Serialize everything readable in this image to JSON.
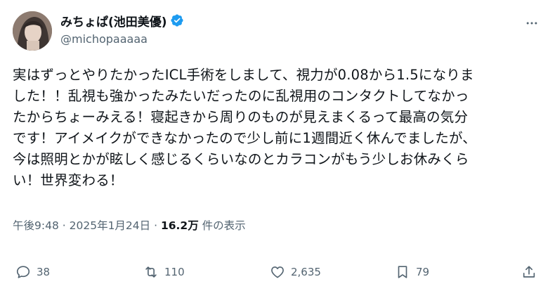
{
  "author": {
    "display_name": "みちょぱ(池田美優)",
    "handle": "@michopaaaaa",
    "verified": true,
    "icon_color": "#1d9bf0"
  },
  "tweet": {
    "lines": [
      "実はずっとやりたかったICL手術をしまして、視力が0.08から1.5になりま",
      "した！！乱視も強かったみたいだったのに乱視用のコンタクトしてなかっ",
      "たからちょーみえる！寝起きから周りのものが見えまくるって最高の気分",
      "です！アイメイクができなかったので少し前に1週間近く休んでましたが、",
      "今は照明とかが眩しく感じるくらいなのとカラコンがもう少しお休みくら",
      "い！世界変わる！"
    ]
  },
  "meta": {
    "time": "午後9:48",
    "separator": "·",
    "date": "2025年1月24日",
    "views_count": "16.2万",
    "views_label": "件の表示"
  },
  "actions": {
    "replies": "38",
    "reposts": "110",
    "likes": "2,635",
    "bookmarks": "79"
  },
  "icons": {
    "more": "more-horizontal-icon",
    "reply": "reply-icon",
    "repost": "repost-icon",
    "like": "heart-icon",
    "bookmark": "bookmark-icon",
    "share": "share-icon"
  }
}
